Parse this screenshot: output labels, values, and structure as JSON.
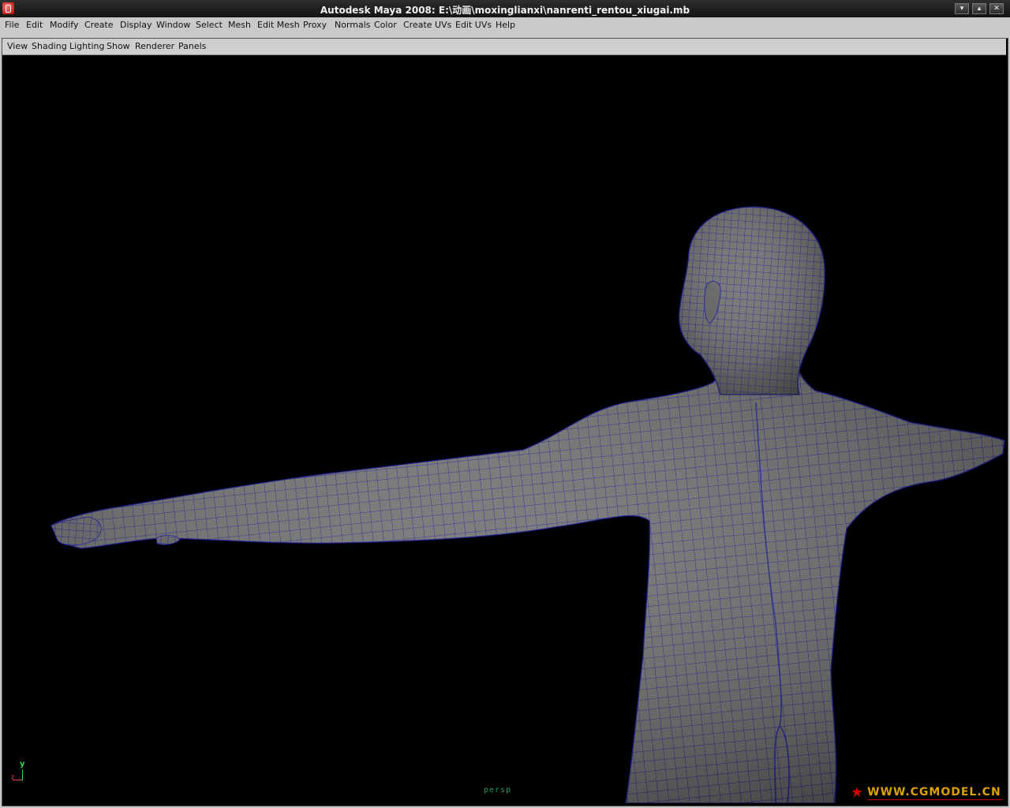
{
  "window": {
    "title": "Autodesk Maya 2008: E:\\动画\\moxinglianxi\\nanrenti_rentou_xiugai.mb",
    "controls": [
      "▾",
      "▴",
      "✕"
    ]
  },
  "menubar": [
    "File",
    "Edit",
    "Modify",
    "Create",
    "Display",
    "Window",
    "Select",
    "Mesh",
    "Edit Mesh",
    "Proxy",
    "Normals",
    "Color",
    "Create UVs",
    "Edit UVs",
    "Help"
  ],
  "panel_menu": [
    "View",
    "Shading",
    "Lighting",
    "Show",
    "Renderer",
    "Panels"
  ],
  "viewport": {
    "camera": "persp",
    "axis_y": "y",
    "axis_z": "z",
    "mesh_color": "#6e6e6e",
    "wire_color": "#1a1a8c"
  },
  "watermark": {
    "star": "★",
    "text": "WWW.CGMODEL.CN"
  },
  "colors": {
    "menu_bg": "#c9c9c9",
    "viewport_bg": "#000000"
  }
}
